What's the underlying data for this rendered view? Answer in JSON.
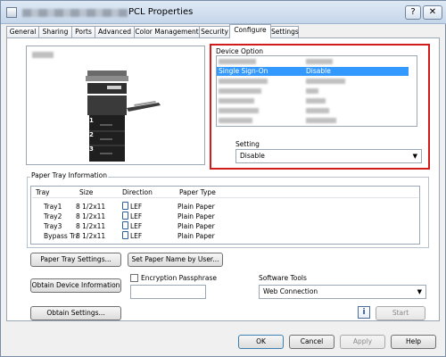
{
  "window": {
    "title": "PCL Properties",
    "help_glyph": "?",
    "close_glyph": "✕"
  },
  "tabs": [
    "General",
    "Sharing",
    "Ports",
    "Advanced",
    "Color Management",
    "Security",
    "Configure",
    "Settings"
  ],
  "preview": {
    "tray_numbers": [
      "1",
      "2",
      "3"
    ]
  },
  "device_option": {
    "label": "Device Option",
    "selected_row": {
      "name": "Single Sign-On",
      "value": "Disable"
    },
    "setting_label": "Setting",
    "setting_value": "Disable"
  },
  "tray_info": {
    "label": "Paper Tray Information",
    "headers": [
      "Tray",
      "Size",
      "Direction",
      "Paper Type"
    ],
    "rows": [
      {
        "tray": "Tray1",
        "size": "8 1/2x11",
        "direction": "LEF",
        "type": "Plain Paper"
      },
      {
        "tray": "Tray2",
        "size": "8 1/2x11",
        "direction": "LEF",
        "type": "Plain Paper"
      },
      {
        "tray": "Tray3",
        "size": "8 1/2x11",
        "direction": "LEF",
        "type": "Plain Paper"
      },
      {
        "tray": "Bypass Tra",
        "size": "8 1/2x11",
        "direction": "LEF",
        "type": "Plain Paper"
      }
    ]
  },
  "buttons": {
    "paper_tray_settings": "Paper Tray Settings...",
    "set_paper_name": "Set Paper Name by User...",
    "obtain_device_info": "Obtain Device Information",
    "obtain_settings": "Obtain Settings...",
    "start": "Start",
    "ok": "OK",
    "cancel": "Cancel",
    "apply": "Apply",
    "help": "Help"
  },
  "encryption": {
    "label": "Encryption Passphrase"
  },
  "software_tools": {
    "label": "Software Tools",
    "value": "Web Connection",
    "info_glyph": "i"
  },
  "colors": {
    "accent_selection": "#3399ff",
    "highlight_frame": "#d21b1b"
  }
}
